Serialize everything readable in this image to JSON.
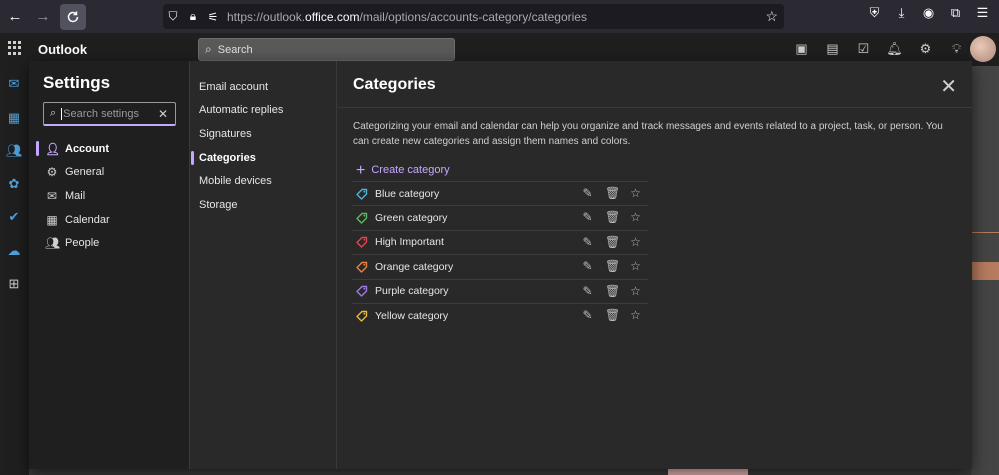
{
  "browser": {
    "url_prefix": "https://outlook.",
    "url_domain": "office.com",
    "url_path": "/mail/options/accounts-category/categories"
  },
  "app": {
    "name": "Outlook",
    "search_placeholder": "Search"
  },
  "settings": {
    "title": "Settings",
    "search_placeholder": "Search settings",
    "categories": [
      {
        "label": "Account",
        "icon": "person-icon",
        "active": true
      },
      {
        "label": "General",
        "icon": "gear-icon",
        "active": false
      },
      {
        "label": "Mail",
        "icon": "mail-icon",
        "active": false
      },
      {
        "label": "Calendar",
        "icon": "calendar-icon",
        "active": false
      },
      {
        "label": "People",
        "icon": "people-icon",
        "active": false
      }
    ],
    "subnav": [
      {
        "label": "Email account",
        "active": false
      },
      {
        "label": "Automatic replies",
        "active": false
      },
      {
        "label": "Signatures",
        "active": false
      },
      {
        "label": "Categories",
        "active": true
      },
      {
        "label": "Mobile devices",
        "active": false
      },
      {
        "label": "Storage",
        "active": false
      }
    ]
  },
  "pane": {
    "title": "Categories",
    "description": "Categorizing your email and calendar can help you organize and track messages and events related to a project, task, or person. You can create new categories and assign them names and colors.",
    "create_label": "Create category",
    "items": [
      {
        "label": "Blue category",
        "color": "#4fb3d9"
      },
      {
        "label": "Green category",
        "color": "#5fb85f"
      },
      {
        "label": "High Important",
        "color": "#e0474c"
      },
      {
        "label": "Orange category",
        "color": "#e8824a"
      },
      {
        "label": "Purple category",
        "color": "#9d7be0"
      },
      {
        "label": "Yellow category",
        "color": "#e7b83a"
      }
    ]
  }
}
